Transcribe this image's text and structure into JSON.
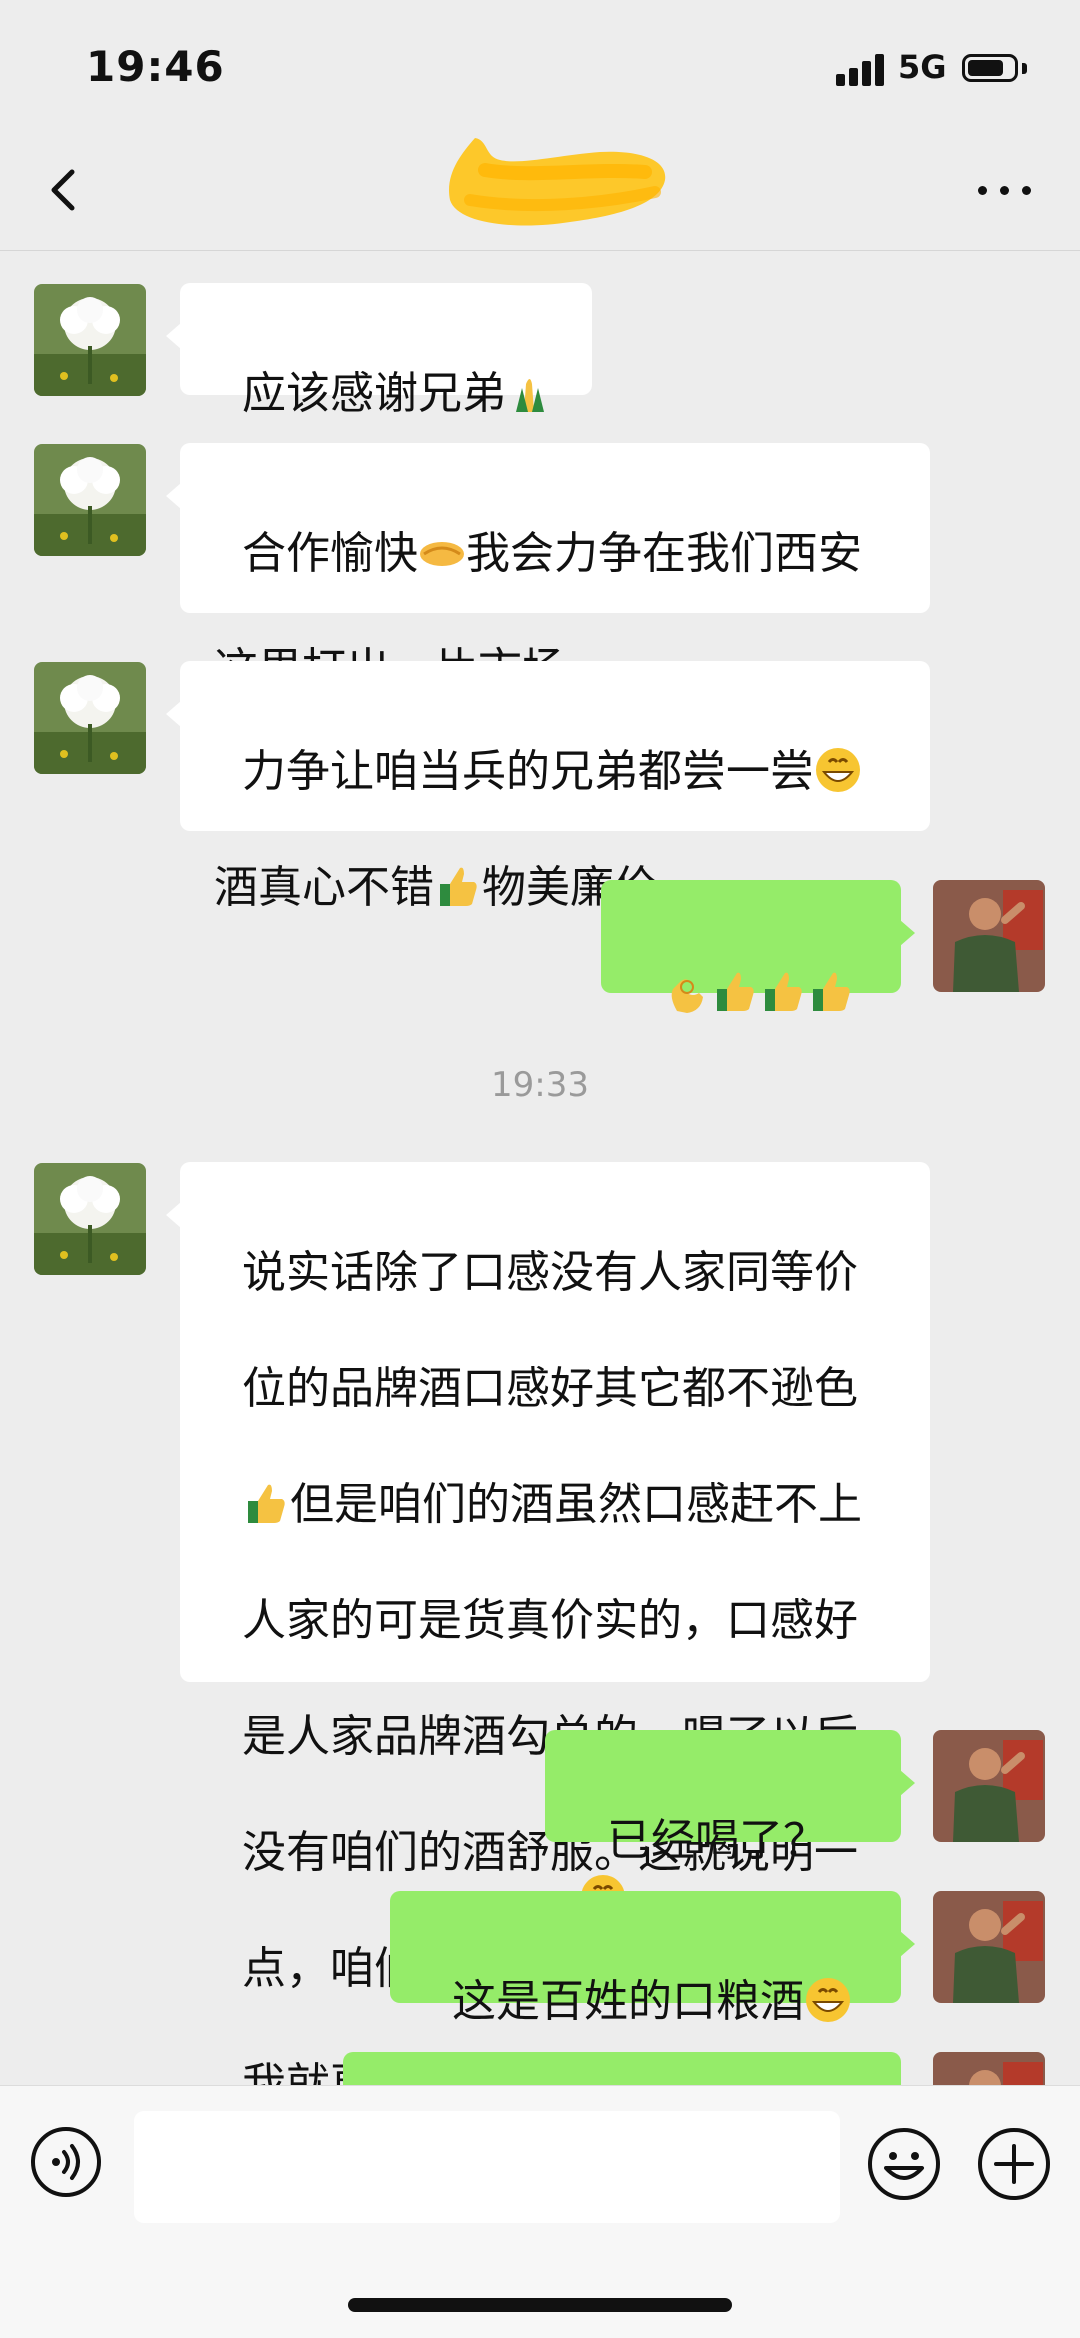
{
  "status_bar": {
    "time": "19:46",
    "network": "5G",
    "battery_level": 0.8
  },
  "nav": {
    "title_redacted": true,
    "back_icon": "chevron-left-icon",
    "more_icon": "more-dots-icon"
  },
  "messages": [
    {
      "side": "in",
      "text": "应该感谢兄弟",
      "emojis": [
        "pray"
      ]
    },
    {
      "side": "in",
      "text": "合作愉快[handshake]我会力争在我们西安\n这里打出一片市场"
    },
    {
      "side": "in",
      "text": "力争让咱当兵的兄弟都尝一尝[grin]\n酒真心不错[thumbsup]物美廉价"
    },
    {
      "side": "out",
      "text": "[ok][thumbsup][thumbsup][thumbsup]"
    },
    {
      "side": "in",
      "text": "说实话除了口感没有人家同等价\n位的品牌酒口感好其它都不逊色\n[thumbsup]但是咱们的酒虽然口感赶不上\n人家的可是货真价实的，口感好\n是人家品牌酒勾兑的，喝了以后\n没有咱们的酒舒服。这就说明一\n点，咱们的酒几乎是原浆酒[grin]这\n我就更有信心了"
    },
    {
      "side": "out",
      "text": "已经喝了？[grin]"
    },
    {
      "side": "out",
      "text": "这是百姓的口粮酒[grin]"
    }
  ],
  "timestamp": "19:33",
  "message_texts": {
    "m1": "应该感谢兄弟",
    "m2a": "合作愉快",
    "m2b": "我会力争在我们西安",
    "m2c": "这里打出一片市场",
    "m3a": "力争让咱当兵的兄弟都尝一尝",
    "m3b": "酒真心不错",
    "m3c": "物美廉价",
    "m5_l1": "说实话除了口感没有人家同等价",
    "m5_l2": "位的品牌酒口感好其它都不逊色",
    "m5_l3": "但是咱们的酒虽然口感赶不上",
    "m5_l4": "人家的可是货真价实的，口感好",
    "m5_l5": "是人家品牌酒勾兑的，喝了以后",
    "m5_l6": "没有咱们的酒舒服。这就说明一",
    "m5_l7a": "点，咱们的酒几乎是原浆酒",
    "m5_l7b": "这",
    "m5_l8": "我就更有信心了",
    "m6": "已经喝了？",
    "m7": "这是百姓的口粮酒"
  },
  "input_bar": {
    "voice_icon": "voice-icon",
    "emoji_icon": "emoji-icon",
    "plus_icon": "plus-icon",
    "input_value": ""
  },
  "colors": {
    "background": "#ededed",
    "bubble_in": "#ffffff",
    "bubble_out": "#95ec69"
  }
}
